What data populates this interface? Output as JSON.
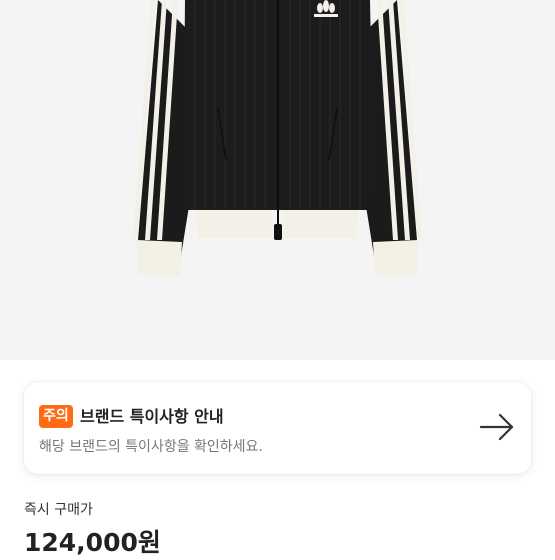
{
  "product": {
    "image_label": "product-photo"
  },
  "notice": {
    "badge": "주의",
    "title": "브랜드 특이사항 안내",
    "description": "해당 브랜드의 특이사항을 확인하세요.",
    "arrow_icon": "arrow-right-icon",
    "badge_color": "#ff6a13"
  },
  "price": {
    "label": "즉시 구매가",
    "value": "124,000원"
  }
}
